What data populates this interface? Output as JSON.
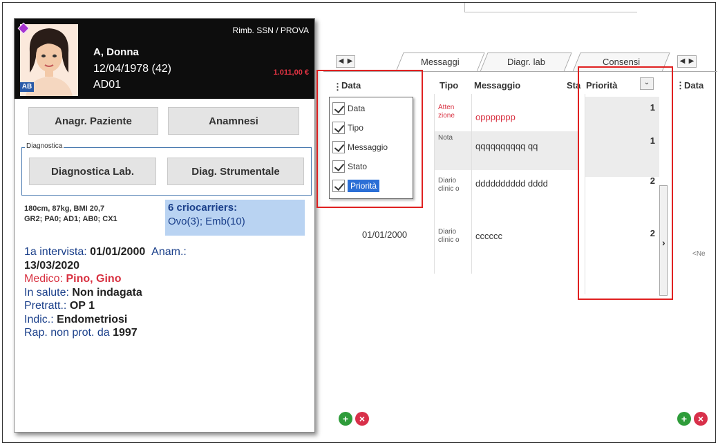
{
  "patient": {
    "name": "A, Donna",
    "dob_age": "12/04/1978  (42)",
    "code": "AD01",
    "regime": "Rimb. SSN / PROVA",
    "amount": "1.011,00 €",
    "tag": "AB"
  },
  "buttons": {
    "anagr": "Anagr. Paziente",
    "anamnesi": "Anamnesi",
    "diag_legend": "Diagnostica",
    "diag_lab": "Diagnostica Lab.",
    "diag_strum": "Diag. Strumentale"
  },
  "measures": {
    "line1": "180cm, 87kg, BMI 20,7",
    "line2": "GR2; PA0; AD1; AB0; CX1"
  },
  "criocarriers": {
    "title": "6 criocarriers:",
    "detail": "Ovo(3); Emb(10)"
  },
  "info": {
    "first_label": "1a intervista:",
    "first_value": "01/01/2000",
    "anam_label": "Anam.:",
    "anam_value": "13/03/2020",
    "medico_label": "Medico:",
    "medico_value": "Pino, Gino",
    "salute_label": "In salute:",
    "salute_value": "Non indagata",
    "pretratt_label": "Pretratt.:",
    "pretratt_value": "OP 1",
    "indic_label": "Indic.:",
    "indic_value": "Endometriosi",
    "rap_label": "Rap. non prot. da",
    "rap_value": "1997"
  },
  "tabs": [
    "Messaggi",
    "Diagr. lab",
    "Consensi"
  ],
  "columns": {
    "data": "Data",
    "tipo": "Tipo",
    "messaggio": "Messaggio",
    "stato": "Sta",
    "priorita": "Priorità",
    "data2": "Data"
  },
  "rows": [
    {
      "date": "",
      "tipo": "Atten zione",
      "msg": "oppppppp",
      "prio": "1"
    },
    {
      "date": "",
      "tipo": "Nota",
      "msg": "qqqqqqqqqq qq",
      "prio": "1"
    },
    {
      "date": "",
      "tipo": "Diario clinic o",
      "msg": "dddddddddd dddd",
      "prio": "2"
    },
    {
      "date": "01/01/2000",
      "tipo": "Diario clinic o",
      "msg": "cccccc",
      "prio": "2"
    }
  ],
  "column_menu": [
    "Data",
    "Tipo",
    "Messaggio",
    "Stato",
    "Priorità"
  ],
  "side_text": "<Ne",
  "colors": {
    "highlight_box": "#e02020",
    "header_bg": "#0d0d0d",
    "crio_bg": "#b9d3f2"
  }
}
